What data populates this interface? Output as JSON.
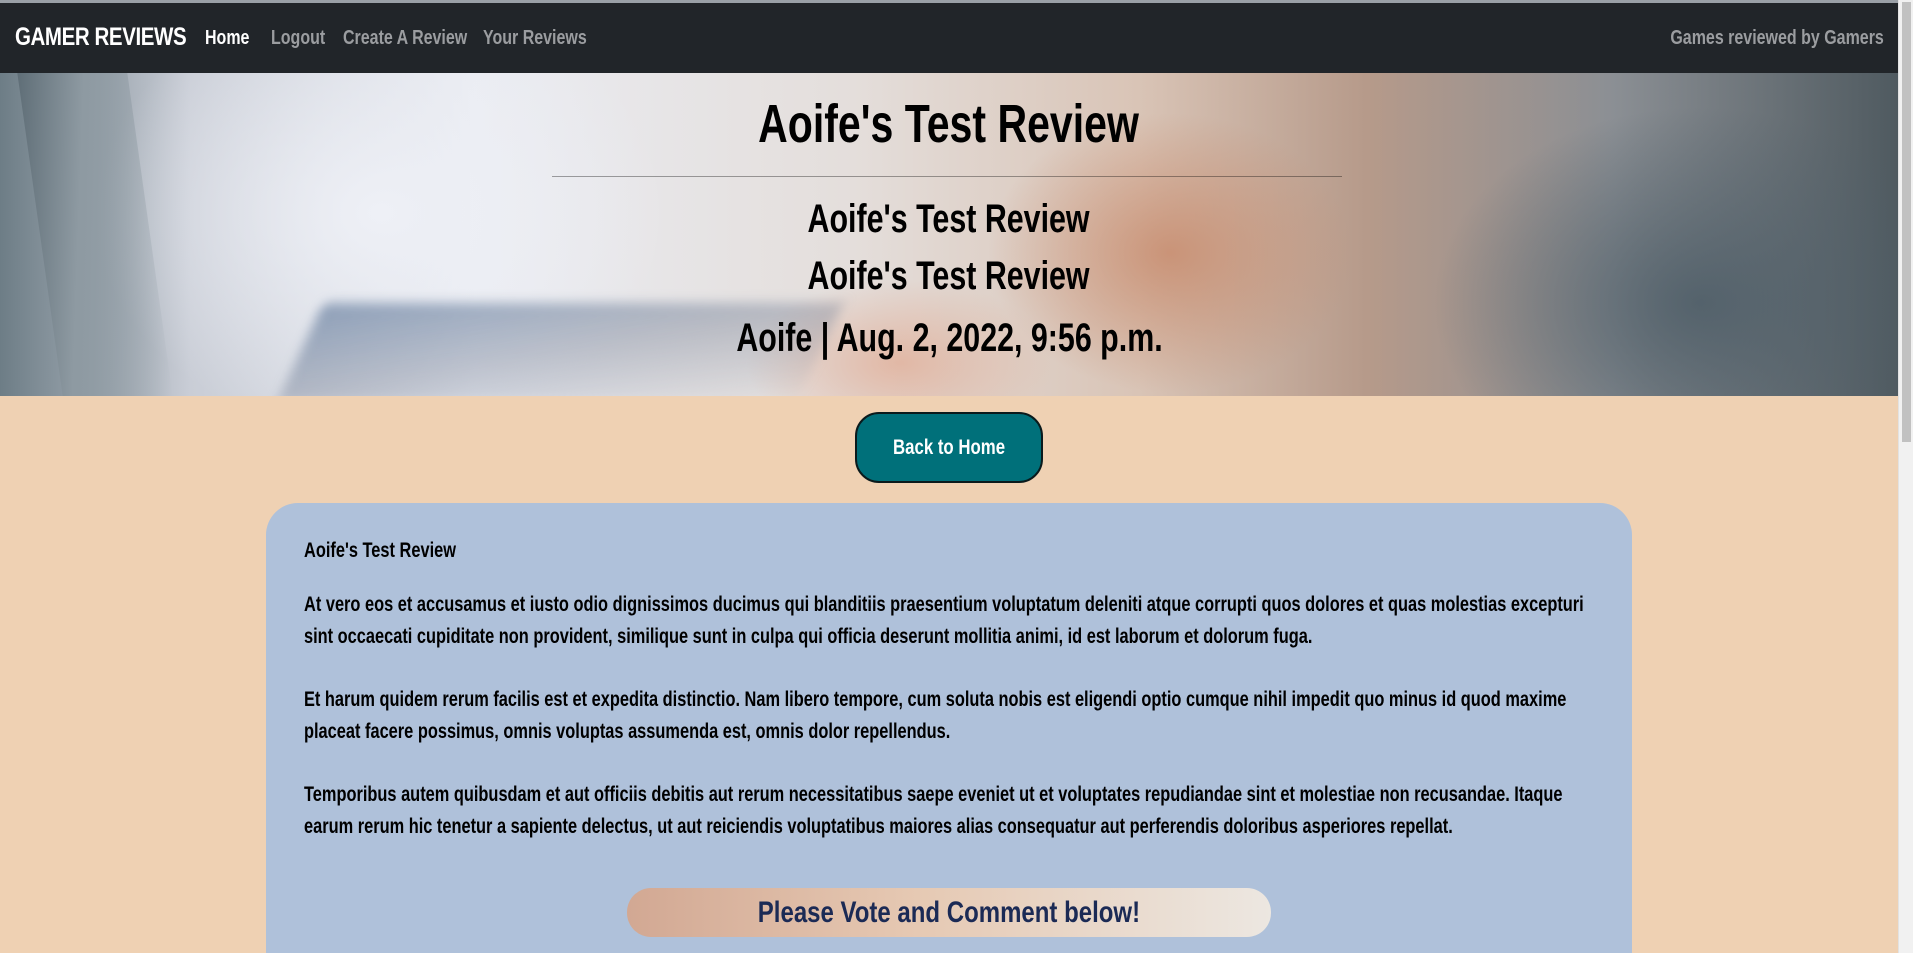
{
  "navbar": {
    "brand": "GAMER REVIEWS",
    "links": [
      {
        "label": "Home",
        "active": true
      },
      {
        "label": "Logout",
        "active": false
      },
      {
        "label": "Create A Review",
        "active": false
      },
      {
        "label": "Your Reviews",
        "active": false
      }
    ],
    "tagline": "Games reviewed by Gamers"
  },
  "hero": {
    "title": "Aoife's Test Review",
    "subtitle_one": "Aoife's Test Review",
    "subtitle_two": "Aoife's Test Review",
    "meta": "Aoife | Aug. 2, 2022, 9:56 p.m."
  },
  "actions": {
    "back_label": "Back to Home"
  },
  "review": {
    "title": "Aoife's Test Review",
    "paragraphs": [
      "At vero eos et accusamus et iusto odio dignissimos ducimus qui blanditiis praesentium voluptatum deleniti atque corrupti quos dolores et quas molestias excepturi sint occaecati cupiditate non provident, similique sunt in culpa qui officia deserunt mollitia animi, id est laborum et dolorum fuga.",
      "Et harum quidem rerum facilis est et expedita distinctio. Nam libero tempore, cum soluta nobis est eligendi optio cumque nihil impedit quo minus id quod maxime placeat facere possimus, omnis voluptas assumenda est, omnis dolor repellendus.",
      "Temporibus autem quibusdam et aut officiis debitis aut rerum necessitatibus saepe eveniet ut et voluptates repudiandae sint et molestiae non recusandae. Itaque earum rerum hic tenetur a sapiente delectus, ut aut reiciendis voluptatibus maiores alias consequatur aut perferendis doloribus asperiores repellat."
    ],
    "vote_banner": "Please Vote and Comment below!"
  },
  "colors": {
    "navbar_bg": "#212529",
    "page_bg": "#efd1b3",
    "card_bg": "#afc1da",
    "back_button_bg": "#00707a",
    "vote_text": "#1b2a55"
  }
}
